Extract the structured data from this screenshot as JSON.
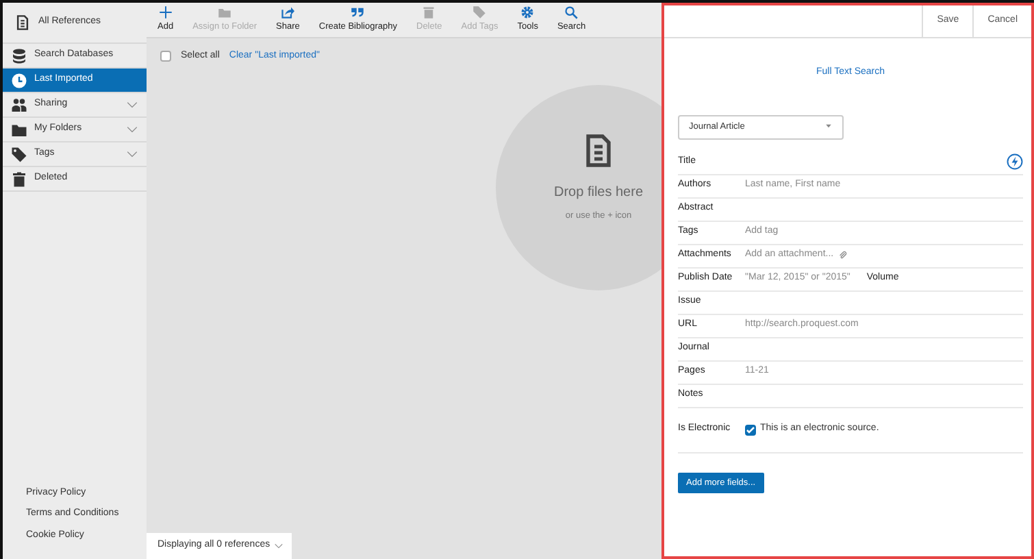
{
  "sidebar": {
    "header": "All References",
    "items": [
      {
        "label": "Search Databases",
        "selected": false
      },
      {
        "label": "Last Imported",
        "selected": true
      },
      {
        "label": "Sharing",
        "selected": false,
        "expandable": true
      },
      {
        "label": "My Folders",
        "selected": false,
        "expandable": true
      },
      {
        "label": "Tags",
        "selected": false,
        "expandable": true
      },
      {
        "label": "Deleted",
        "selected": false
      }
    ],
    "footer_links": [
      "Privacy Policy",
      "Terms and Conditions",
      "Cookie Policy"
    ]
  },
  "toolbar": [
    {
      "label": "Add",
      "disabled": false
    },
    {
      "label": "Assign to Folder",
      "disabled": true
    },
    {
      "label": "Share",
      "disabled": false
    },
    {
      "label": "Create Bibliography",
      "disabled": false
    },
    {
      "label": "Delete",
      "disabled": true
    },
    {
      "label": "Add Tags",
      "disabled": true
    },
    {
      "label": "Tools",
      "disabled": false
    },
    {
      "label": "Search",
      "disabled": false
    }
  ],
  "select_all": {
    "label": "Select all",
    "checked": false
  },
  "clear_link": "Clear \"Last imported\"",
  "drop_zone": {
    "title": "Drop files here",
    "hint": "or use the + icon"
  },
  "status": "Displaying all 0 references",
  "editor": {
    "buttons": [
      "Save",
      "Cancel"
    ],
    "full_text_link": "Full Text Search",
    "type_select": "Journal Article",
    "fields": [
      {
        "kind": "text",
        "label": "Title"
      },
      {
        "kind": "text",
        "label": "Authors",
        "placeholder": "Last name, First name"
      },
      {
        "kind": "text",
        "label": "Abstract"
      },
      {
        "kind": "text",
        "label": "Tags",
        "placeholder": "Add tag"
      },
      {
        "kind": "attachment",
        "label": "Attachments",
        "placeholder": "Add an attachment..."
      },
      {
        "kind": "text",
        "label": "Publish Date",
        "placeholder": "\"Mar 12, 2015\" or \"2015\"",
        "second_label": "Volume"
      },
      {
        "kind": "text",
        "label": "Issue"
      },
      {
        "kind": "text",
        "label": "URL",
        "placeholder": "http://search.proquest.com"
      },
      {
        "kind": "text",
        "label": "Journal"
      },
      {
        "kind": "text",
        "label": "Pages",
        "placeholder": "11-21"
      },
      {
        "kind": "text",
        "label": "Notes"
      },
      {
        "kind": "checkbox",
        "label": "Is Electronic",
        "checked": true,
        "text": "This is an electronic source."
      }
    ],
    "add_button": "Add more fields..."
  }
}
